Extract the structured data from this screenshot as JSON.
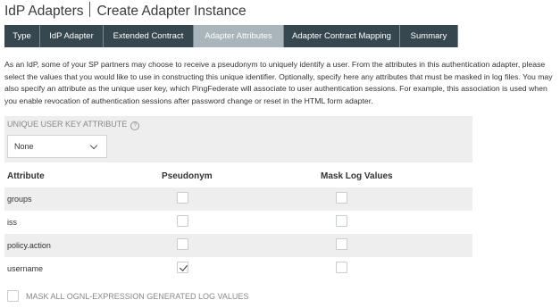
{
  "header": {
    "title": "IdP Adapters",
    "subtitle": "Create Adapter Instance"
  },
  "tabs": [
    {
      "label": "Type",
      "active": false
    },
    {
      "label": "IdP Adapter",
      "active": false
    },
    {
      "label": "Extended Contract",
      "active": false
    },
    {
      "label": "Adapter Attributes",
      "active": true
    },
    {
      "label": "Adapter Contract Mapping",
      "active": false
    },
    {
      "label": "Summary",
      "active": false
    }
  ],
  "description": "As an IdP, some of your SP partners may choose to receive a pseudonym to uniquely identify a user. From the attributes in this authentication adapter, please select the values that you would like to use in constructing this unique identifier. Optionally, specify here any attributes that must be masked in log files. You may also specify an attribute as the unique user key, which PingFederate will associate to user authentication sessions. For example, this association is used when you enable revocation of authentication sessions after password change or reset in the HTML form adapter.",
  "unique_user_key": {
    "label": "UNIQUE USER KEY ATTRIBUTE",
    "help_icon": "?",
    "selected": "None"
  },
  "table": {
    "columns": [
      "Attribute",
      "Pseudonym",
      "Mask Log Values"
    ],
    "rows": [
      {
        "name": "groups",
        "pseudonym": false,
        "mask": false
      },
      {
        "name": "iss",
        "pseudonym": false,
        "mask": false
      },
      {
        "name": "policy.action",
        "pseudonym": false,
        "mask": false
      },
      {
        "name": "username",
        "pseudonym": true,
        "mask": false
      }
    ]
  },
  "mask_all": {
    "label": "MASK ALL OGNL-EXPRESSION GENERATED LOG VALUES",
    "checked": false
  },
  "colors": {
    "tab_bg": "#37474f",
    "tab_active_bg": "#aab5bb",
    "row_shade": "#eeeeee"
  }
}
